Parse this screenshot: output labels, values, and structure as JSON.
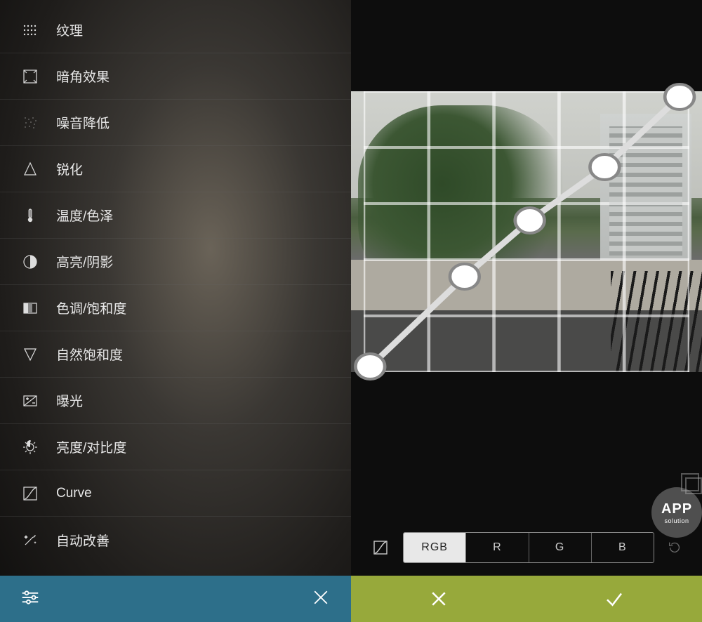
{
  "left_menu": {
    "items": [
      {
        "icon": "grain-icon",
        "label": "纹理"
      },
      {
        "icon": "vignette-icon",
        "label": "暗角效果"
      },
      {
        "icon": "noise-icon",
        "label": "噪音降低"
      },
      {
        "icon": "sharpen-icon",
        "label": "锐化"
      },
      {
        "icon": "thermometer-icon",
        "label": "温度/色泽"
      },
      {
        "icon": "highlight-shadow-icon",
        "label": "高亮/阴影"
      },
      {
        "icon": "levels-icon",
        "label": "色调/饱和度"
      },
      {
        "icon": "vibrance-icon",
        "label": "自然饱和度"
      },
      {
        "icon": "exposure-icon",
        "label": "曝光"
      },
      {
        "icon": "brightness-contrast-icon",
        "label": "亮度/对比度"
      },
      {
        "icon": "curve-icon",
        "label": "Curve"
      },
      {
        "icon": "auto-enhance-icon",
        "label": "自动改善"
      }
    ],
    "footer": {
      "settings_icon": "sliders-icon",
      "close_icon": "close-icon"
    }
  },
  "curve_editor": {
    "channels": [
      "RGB",
      "R",
      "G",
      "B"
    ],
    "active_channel": "RGB",
    "points": [
      {
        "x": 0.02,
        "y": 0.98
      },
      {
        "x": 0.31,
        "y": 0.66
      },
      {
        "x": 0.51,
        "y": 0.46
      },
      {
        "x": 0.74,
        "y": 0.27
      },
      {
        "x": 0.97,
        "y": 0.02
      }
    ],
    "grid_divisions": 5
  },
  "watermark": {
    "title": "APP",
    "subtitle": "solution"
  },
  "colors": {
    "left_footer_bg": "#2d6f8a",
    "right_footer_bg": "#97a93b"
  }
}
